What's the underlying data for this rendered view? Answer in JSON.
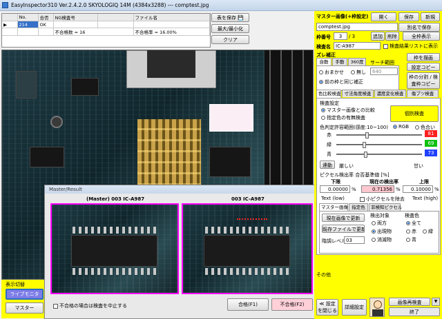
{
  "window": {
    "title": "EasyInspector310 Ver.2.4.2.0 SKYOLOGIQ 14M  (4384x3288)  --- comptest.jpg"
  },
  "grid": {
    "headers": [
      "",
      "No.",
      "合否",
      "NG検査号",
      "",
      "ファイル名"
    ],
    "rows": [
      [
        "▶",
        "214",
        "OK",
        "",
        "",
        ""
      ],
      [
        "",
        "",
        "",
        "不合格数 = 16",
        "不合格率 = 16.00%",
        ""
      ]
    ]
  },
  "toolbar": {
    "save_table": "表を保存",
    "toggle_size": "最大/最小化",
    "clear": "クリア"
  },
  "master": {
    "title": "マスター画像(+枠設定)",
    "open": "開く",
    "save": "保存",
    "new": "新規",
    "filename": "comptest.jpg",
    "save_as": "別名で保存",
    "frame_label": "枠番号",
    "frame_value": "3",
    "frame_total": "/ 3",
    "add": "追加",
    "delete": "削除",
    "show_all": "全枠表示",
    "name_label": "検査名",
    "name_value": "IC-A987",
    "checklist": "検査結果リストに表示"
  },
  "shift": {
    "title": "ズレ補正",
    "tabs": [
      "自動",
      "手動",
      "360度"
    ],
    "search_label": "サーチ範囲",
    "search_value": "640",
    "opt_auto": "おまかせ",
    "opt_none": "無し",
    "opt_same": "前の枠と同じ補正",
    "draw_frame": "枠を描画",
    "copy_settings": "設定コピー",
    "batch_copy": "枠の分割 / 検査枠コピー"
  },
  "inspect_tabs": [
    "色比較検査",
    "寸法角度検査",
    "濃度変化検査",
    "傷ブツ検査"
  ],
  "color": {
    "settings_label": "検査設定",
    "mode1": "マスター画像との比較",
    "mode2": "指定色の有無検査",
    "individual": "個別検査",
    "tol_label": "色判定許容範囲(感度:10~100)",
    "rgb": "RGB",
    "hue": "色合い",
    "r": "赤",
    "g": "緑",
    "b": "青",
    "r_val": "81",
    "g_val": "69",
    "b_val": "73",
    "link": "連動",
    "strict": "厳しい",
    "loose": "甘い",
    "pixel_title": "ピクセル検出率 合否基準値 [%]",
    "lower": "下限",
    "current": "現在の検出率",
    "upper": "上限",
    "lower_val": "0.00000",
    "current_val": "0.71356",
    "upper_val": "0.10000",
    "pct": "%",
    "text_low": "Text (low)",
    "remove_small": "小ピクセルを除去",
    "text_high": "Text (high)"
  },
  "subtabs": [
    "マスター画像",
    "指定色",
    "非検知ピクセル"
  ],
  "subpanel": {
    "update_current": "現在画像で更新",
    "update_file": "既存ファイルで更新",
    "target": "検出対象",
    "target_both": "両方",
    "target_out": "出現物",
    "target_gone": "消滅物",
    "color": "検査色",
    "all": "全て",
    "red": "赤",
    "green": "緑",
    "blue": "青",
    "gray_label": "階調レベル",
    "gray_val": "03"
  },
  "other": {
    "label": "その他",
    "reset": "≪ 設定を閉じる",
    "details": "詳細設定",
    "reinspect": "画像再検査",
    "exit": "終了"
  },
  "display": {
    "label": "表示切替",
    "live": "ライブモニタ",
    "master": "マスター"
  },
  "result": {
    "title": "Master/Result",
    "left": "(Master) 003 IC-A987",
    "right": "003 IC-A987",
    "stop": "不合格の場合は検査を中止する",
    "pass": "合格(F1)",
    "fail": "不合格(F2)"
  }
}
